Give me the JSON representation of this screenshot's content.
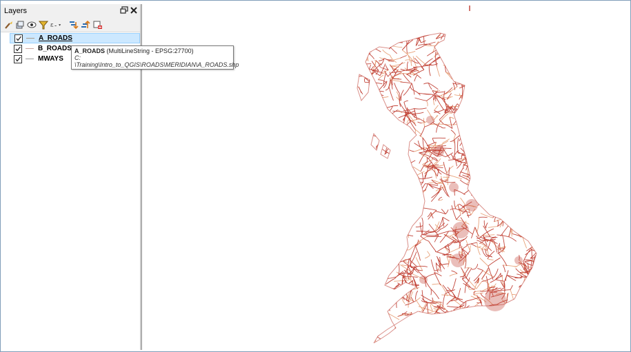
{
  "panel": {
    "title": "Layers",
    "toolbar_icons": [
      "open-layer-styling-icon",
      "add-group-icon",
      "manage-map-themes-icon",
      "filter-legend-icon",
      "filter-by-expression-icon",
      "expand-all-icon",
      "collapse-all-icon",
      "remove-layer-icon"
    ]
  },
  "layers": [
    {
      "name": "A_ROADS",
      "checked": true,
      "selected": true
    },
    {
      "name": "B_ROADS",
      "checked": true,
      "selected": false
    },
    {
      "name": "MWAYS",
      "checked": true,
      "selected": false
    }
  ],
  "tooltip": {
    "layer_name": "A_ROADS",
    "geometry_info": "(MultiLineString - EPSG:27700)",
    "drive": "C:",
    "path": "\\Training\\Intro_to_QGIS\\ROADS\\MERIDIAN\\A_ROADS.shp"
  },
  "map": {
    "road_color": "#c2453a",
    "road_color_light": "#e8a27a"
  }
}
